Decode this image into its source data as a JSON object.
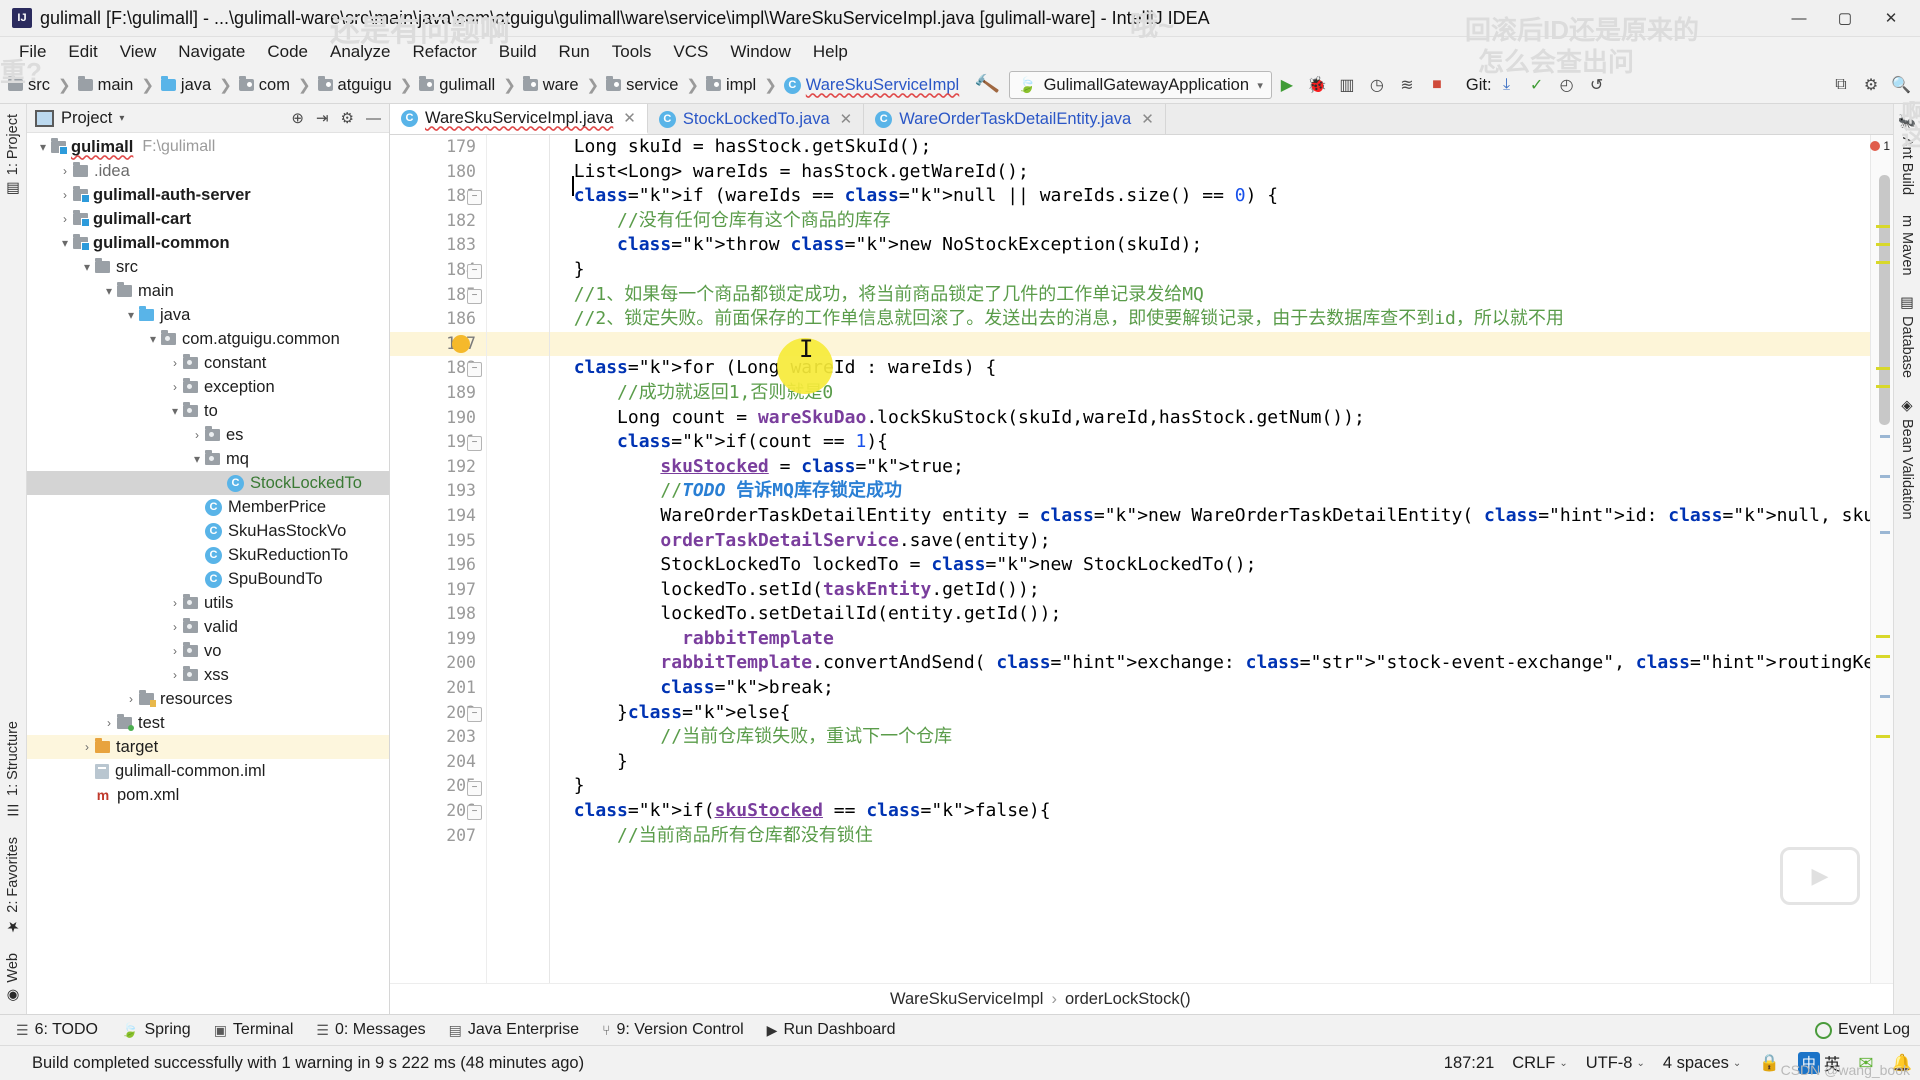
{
  "window": {
    "title": "gulimall [F:\\gulimall] - ...\\gulimall-ware\\src\\main\\java\\com\\atguigu\\gulimall\\ware\\service\\impl\\WareSkuServiceImpl.java [gulimall-ware] - IntelliJ IDEA",
    "minimize": "—",
    "maximize": "▢",
    "close": "✕",
    "logo": "IJ"
  },
  "menu": {
    "items": [
      "File",
      "Edit",
      "View",
      "Navigate",
      "Code",
      "Analyze",
      "Refactor",
      "Build",
      "Run",
      "Tools",
      "VCS",
      "Window",
      "Help"
    ]
  },
  "toolbar": {
    "breadcrumbs": [
      {
        "label": "src",
        "icon": "folder-icon",
        "kind": "folder"
      },
      {
        "label": "main",
        "icon": "folder-icon",
        "kind": "folder"
      },
      {
        "label": "java",
        "icon": "folder-blue-icon",
        "kind": "source-folder"
      },
      {
        "label": "com",
        "icon": "package-icon",
        "kind": "package"
      },
      {
        "label": "atguigu",
        "icon": "package-icon",
        "kind": "package"
      },
      {
        "label": "gulimall",
        "icon": "package-icon",
        "kind": "package"
      },
      {
        "label": "ware",
        "icon": "package-icon",
        "kind": "package"
      },
      {
        "label": "service",
        "icon": "package-icon",
        "kind": "package"
      },
      {
        "label": "impl",
        "icon": "package-icon",
        "kind": "package"
      },
      {
        "label": "WareSkuServiceImpl",
        "icon": "class-icon",
        "kind": "class"
      }
    ],
    "run_config": "GulimallGatewayApplication",
    "run_config_chevron": "▾",
    "git_label": "Git:",
    "icons": [
      "build-hammer-icon",
      "run-icon",
      "debug-icon",
      "run-with-coverage-icon",
      "profiler-icon",
      "stop-icon",
      "update-project-icon",
      "commit-icon",
      "history-icon",
      "rollback-icon",
      "search-everywhere-icon",
      "settings-icon"
    ],
    "search_icon": "search-icon"
  },
  "project_panel": {
    "title": "Project",
    "caret": "▾",
    "locate_icon": "locate-icon",
    "collapse_icon": "collapse-all-icon",
    "settings_icon": "gear-icon",
    "hide_icon": "hide-icon",
    "tree": [
      {
        "depth": 0,
        "arrow": "▾",
        "icon": "module-icon",
        "label": "gulimall",
        "bold": true,
        "muted": "F:\\gulimall",
        "squiggle": true
      },
      {
        "depth": 1,
        "arrow": "›",
        "icon": "folder-icon",
        "label": ".idea",
        "bold": false,
        "dim": true
      },
      {
        "depth": 1,
        "arrow": "›",
        "icon": "module-icon",
        "label": "gulimall-auth-server",
        "bold": true
      },
      {
        "depth": 1,
        "arrow": "›",
        "icon": "module-icon",
        "label": "gulimall-cart",
        "bold": true
      },
      {
        "depth": 1,
        "arrow": "▾",
        "icon": "module-icon",
        "label": "gulimall-common",
        "bold": true
      },
      {
        "depth": 2,
        "arrow": "▾",
        "icon": "folder-icon",
        "label": "src",
        "bold": false
      },
      {
        "depth": 3,
        "arrow": "▾",
        "icon": "folder-icon",
        "label": "main",
        "bold": false
      },
      {
        "depth": 4,
        "arrow": "▾",
        "icon": "folder-blue-icon",
        "label": "java",
        "bold": false
      },
      {
        "depth": 5,
        "arrow": "▾",
        "icon": "package-icon",
        "label": "com.atguigu.common",
        "bold": false
      },
      {
        "depth": 6,
        "arrow": "›",
        "icon": "package-icon",
        "label": "constant",
        "bold": false
      },
      {
        "depth": 6,
        "arrow": "›",
        "icon": "package-icon",
        "label": "exception",
        "bold": false
      },
      {
        "depth": 6,
        "arrow": "▾",
        "icon": "package-icon",
        "label": "to",
        "bold": false
      },
      {
        "depth": 7,
        "arrow": "›",
        "icon": "package-icon",
        "label": "es",
        "bold": false
      },
      {
        "depth": 7,
        "arrow": "▾",
        "icon": "package-icon",
        "label": "mq",
        "bold": false
      },
      {
        "depth": 8,
        "arrow": "",
        "icon": "class-icon",
        "label": "StockLockedTo",
        "bold": false,
        "selected": true,
        "green": true
      },
      {
        "depth": 7,
        "arrow": "",
        "icon": "class-icon",
        "label": "MemberPrice",
        "bold": false
      },
      {
        "depth": 7,
        "arrow": "",
        "icon": "class-icon",
        "label": "SkuHasStockVo",
        "bold": false
      },
      {
        "depth": 7,
        "arrow": "",
        "icon": "class-icon",
        "label": "SkuReductionTo",
        "bold": false
      },
      {
        "depth": 7,
        "arrow": "",
        "icon": "class-icon",
        "label": "SpuBoundTo",
        "bold": false
      },
      {
        "depth": 6,
        "arrow": "›",
        "icon": "package-icon",
        "label": "utils",
        "bold": false
      },
      {
        "depth": 6,
        "arrow": "›",
        "icon": "package-icon",
        "label": "valid",
        "bold": false
      },
      {
        "depth": 6,
        "arrow": "›",
        "icon": "package-icon",
        "label": "vo",
        "bold": false
      },
      {
        "depth": 6,
        "arrow": "›",
        "icon": "package-icon",
        "label": "xss",
        "bold": false
      },
      {
        "depth": 4,
        "arrow": "›",
        "icon": "resources-icon",
        "label": "resources",
        "bold": false
      },
      {
        "depth": 3,
        "arrow": "›",
        "icon": "test-folder-icon",
        "label": "test",
        "bold": false
      },
      {
        "depth": 2,
        "arrow": "›",
        "icon": "target-folder-icon",
        "label": "target",
        "bold": false,
        "highlight": true
      },
      {
        "depth": 2,
        "arrow": "",
        "icon": "iml-file-icon",
        "label": "gulimall-common.iml",
        "bold": false
      },
      {
        "depth": 2,
        "arrow": "",
        "icon": "maven-pom-icon",
        "label": "pom.xml",
        "bold": false
      }
    ]
  },
  "editor": {
    "tabs": [
      {
        "label": "WareSkuServiceImpl.java",
        "icon": "class-icon",
        "active": true,
        "close": "✕"
      },
      {
        "label": "StockLockedTo.java",
        "icon": "class-icon",
        "active": false,
        "close": "✕"
      },
      {
        "label": "WareOrderTaskDetailEntity.java",
        "icon": "class-icon",
        "active": false,
        "close": "✕"
      }
    ],
    "first_line": 179,
    "current_line": 187,
    "lines": [
      {
        "n": 179,
        "text": "        Long skuId = hasStock.getSkuId();"
      },
      {
        "n": 180,
        "text": "        List<Long> wareIds = hasStock.getWareId();"
      },
      {
        "n": 181,
        "text": "        if (wareIds == null || wareIds.size() == 0) {"
      },
      {
        "n": 182,
        "text": "            //没有任何仓库有这个商品的库存"
      },
      {
        "n": 183,
        "text": "            throw new NoStockException(skuId);"
      },
      {
        "n": 184,
        "text": "        }"
      },
      {
        "n": 185,
        "text": "        //1、如果每一个商品都锁定成功，将当前商品锁定了几件的工作单记录发给MQ"
      },
      {
        "n": 186,
        "text": "        //2、锁定失败。前面保存的工作单信息就回滚了。发送出去的消息，即使要解锁记录，由于去数据库查不到id，所以就不用"
      },
      {
        "n": 187,
        "text": "        //        "
      },
      {
        "n": 188,
        "text": "        for (Long wareId : wareIds) {"
      },
      {
        "n": 189,
        "text": "            //成功就返回1,否则就是0"
      },
      {
        "n": 190,
        "text": "            Long count = wareSkuDao.lockSkuStock(skuId,wareId,hasStock.getNum());"
      },
      {
        "n": 191,
        "text": "            if(count == 1){"
      },
      {
        "n": 192,
        "text": "                skuStocked = true;"
      },
      {
        "n": 193,
        "text": "                //TODO 告诉MQ库存锁定成功"
      },
      {
        "n": 194,
        "text": "                WareOrderTaskDetailEntity entity = new WareOrderTaskDetailEntity( id: null, skuId,  skuNam"
      },
      {
        "n": 195,
        "text": "                orderTaskDetailService.save(entity);"
      },
      {
        "n": 196,
        "text": "                StockLockedTo lockedTo = new StockLockedTo();"
      },
      {
        "n": 197,
        "text": "                lockedTo.setId(taskEntity.getId());"
      },
      {
        "n": 198,
        "text": "                lockedTo.setDetailId(entity.getId());"
      },
      {
        "n": 199,
        "text": "                  rabbitTemplate"
      },
      {
        "n": 200,
        "text": "                rabbitTemplate.convertAndSend( exchange: \"stock-event-exchange\", routingKey: \"stock.locked\""
      },
      {
        "n": 201,
        "text": "                break;"
      },
      {
        "n": 202,
        "text": "            }else{"
      },
      {
        "n": 203,
        "text": "                //当前仓库锁失败，重试下一个仓库"
      },
      {
        "n": 204,
        "text": "            }"
      },
      {
        "n": 205,
        "text": "        }"
      },
      {
        "n": 206,
        "text": "        if(skuStocked == false){"
      },
      {
        "n": 207,
        "text": "            //当前商品所有仓库都没有锁住"
      }
    ],
    "breadcrumb": [
      "WareSkuServiceImpl",
      "orderLockStock()"
    ],
    "breadcrumb_sep": "›",
    "error_count": "1"
  },
  "tool_windows": {
    "left": [
      {
        "label": "1: Project",
        "icon": "project-icon"
      },
      {
        "label": "1: Structure",
        "icon": "structure-icon"
      },
      {
        "label": "2: Favorites",
        "icon": "favorites-icon"
      },
      {
        "label": "Web",
        "icon": "web-icon"
      }
    ],
    "right": [
      {
        "label": "Ant Build",
        "icon": "ant-icon"
      },
      {
        "label": "Maven",
        "icon": "maven-icon"
      },
      {
        "label": "Database",
        "icon": "database-icon"
      },
      {
        "label": "Bean Validation",
        "icon": "bean-validation-icon"
      }
    ],
    "bottom": [
      {
        "label": "6: TODO",
        "icon": "todo-icon"
      },
      {
        "label": "Spring",
        "icon": "spring-icon"
      },
      {
        "label": "Terminal",
        "icon": "terminal-icon"
      },
      {
        "label": "0: Messages",
        "icon": "messages-icon"
      },
      {
        "label": "Java Enterprise",
        "icon": "java-ee-icon"
      },
      {
        "label": "9: Version Control",
        "icon": "version-control-icon"
      },
      {
        "label": "Run Dashboard",
        "icon": "run-dashboard-icon"
      }
    ],
    "event_log": "Event Log"
  },
  "statusbar": {
    "message": "Build completed successfully with 1 warning in 9 s 222 ms (48 minutes ago)",
    "caret": "187:21",
    "line_separator": "CRLF",
    "encoding": "UTF-8",
    "indent": "4 spaces",
    "ime": "英",
    "ime_sub": "中",
    "wechat": "微信",
    "lock_icon": "lock-icon",
    "separator_chevron": "⌄"
  },
  "annotations": {
    "note1": "还是有问题啊",
    "note2": "哦~",
    "note3": "回滚后ID还是原来的",
    "note4": "怎么会查出问",
    "note5": "重?",
    "note6": "啊这",
    "watermark": "CSDN @wang_book"
  }
}
